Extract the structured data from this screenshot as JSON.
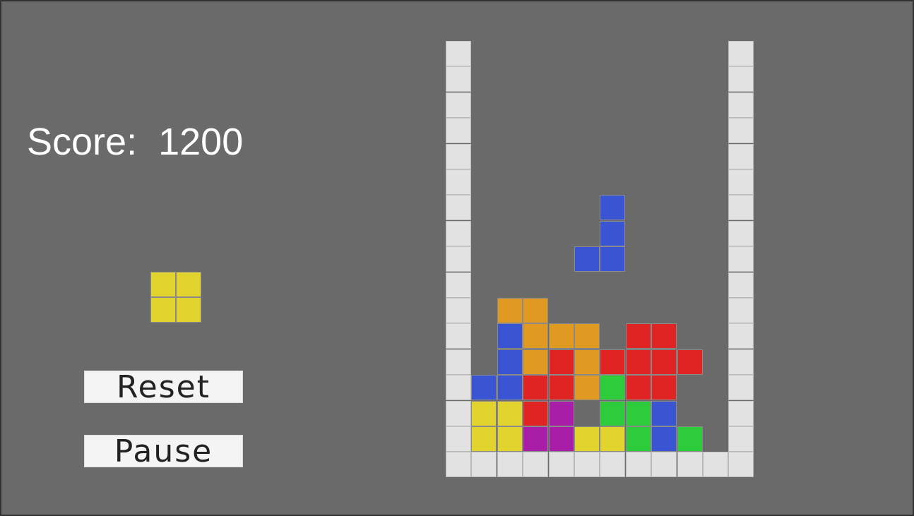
{
  "score": {
    "label": "Score:",
    "value": "1200"
  },
  "buttons": {
    "reset_label": "Reset",
    "pause_label": "Pause"
  },
  "colors": {
    "background": "#6a6a6a",
    "wall": "#e2e2e2",
    "Y": "#e2d42e",
    "O": "#e09a22",
    "B": "#3a55d4",
    "R": "#e02424",
    "G": "#2ecc3a",
    "P": "#a81ea8"
  },
  "next_piece": {
    "type": "O",
    "color_key": "Y",
    "cells": [
      [
        0,
        0
      ],
      [
        1,
        0
      ],
      [
        0,
        1
      ],
      [
        1,
        1
      ]
    ]
  },
  "board": {
    "columns": 10,
    "rows": 16,
    "grid": [
      "..........",
      "..........",
      "..........",
      "..........",
      "..........",
      "..........",
      "..........",
      "..........",
      "..........",
      "..........",
      ".OO.......",
      ".BOOO.RR..",
      ".BORORRRR.",
      "BBRROGRR..",
      "YYRP.GGB..",
      "YYPPYYGBG."
    ],
    "falling_piece": {
      "type": "J",
      "color_key": "B",
      "cells": [
        [
          5,
          6
        ],
        [
          5,
          7
        ],
        [
          4,
          8
        ],
        [
          5,
          8
        ]
      ]
    }
  }
}
